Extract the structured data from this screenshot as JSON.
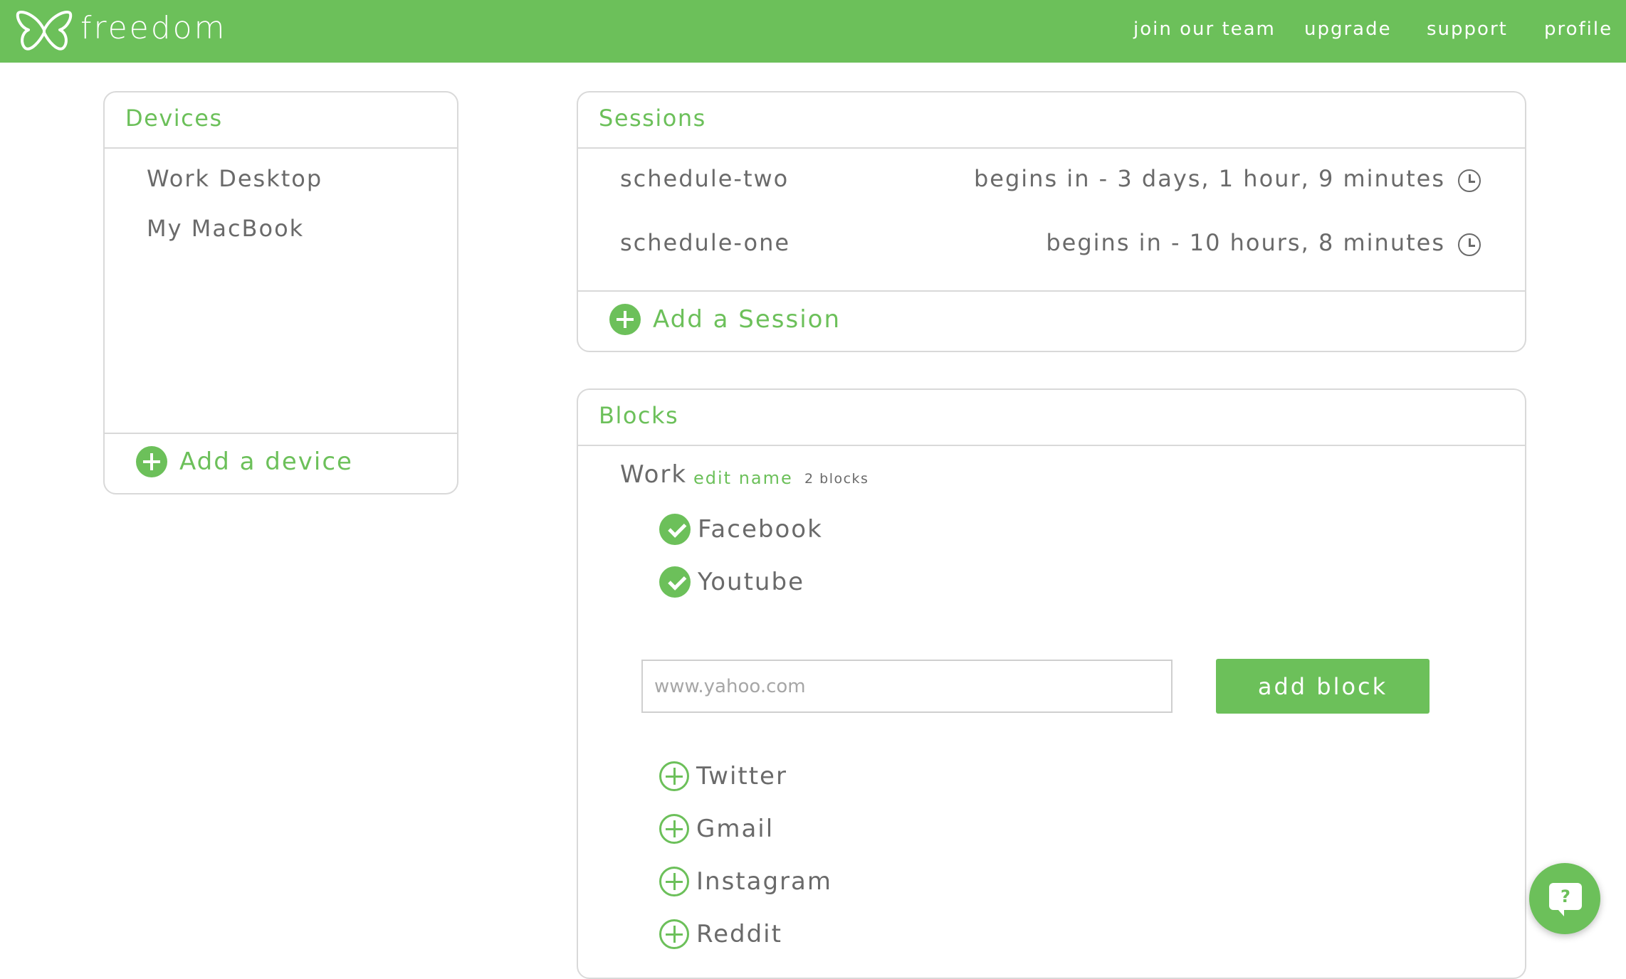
{
  "brand": {
    "name": "freedom",
    "logo_icon": "butterfly-icon"
  },
  "nav": [
    "join our team",
    "upgrade",
    "support",
    "profile"
  ],
  "devices": {
    "title": "Devices",
    "items": [
      "Work Desktop",
      "My MacBook"
    ],
    "add_label": "Add a device"
  },
  "sessions": {
    "title": "Sessions",
    "items": [
      {
        "name": "schedule-two",
        "time": "begins in - 3 days, 1 hour, 9 minutes"
      },
      {
        "name": "schedule-one",
        "time": "begins in - 10 hours, 8 minutes"
      }
    ],
    "add_label": "Add a Session"
  },
  "blocks": {
    "title": "Blocks",
    "group": {
      "name": "Work",
      "edit_label": "edit name",
      "count": "2 blocks"
    },
    "checked": [
      "Facebook",
      "Youtube"
    ],
    "input_placeholder": "www.yahoo.com",
    "add_button": "add block",
    "suggestions": [
      "Twitter",
      "Gmail",
      "Instagram",
      "Reddit"
    ]
  },
  "help": {
    "glyph": "?"
  },
  "colors": {
    "accent": "#6cc05a",
    "text": "#6a6a6a",
    "border": "#d9d9d9"
  }
}
